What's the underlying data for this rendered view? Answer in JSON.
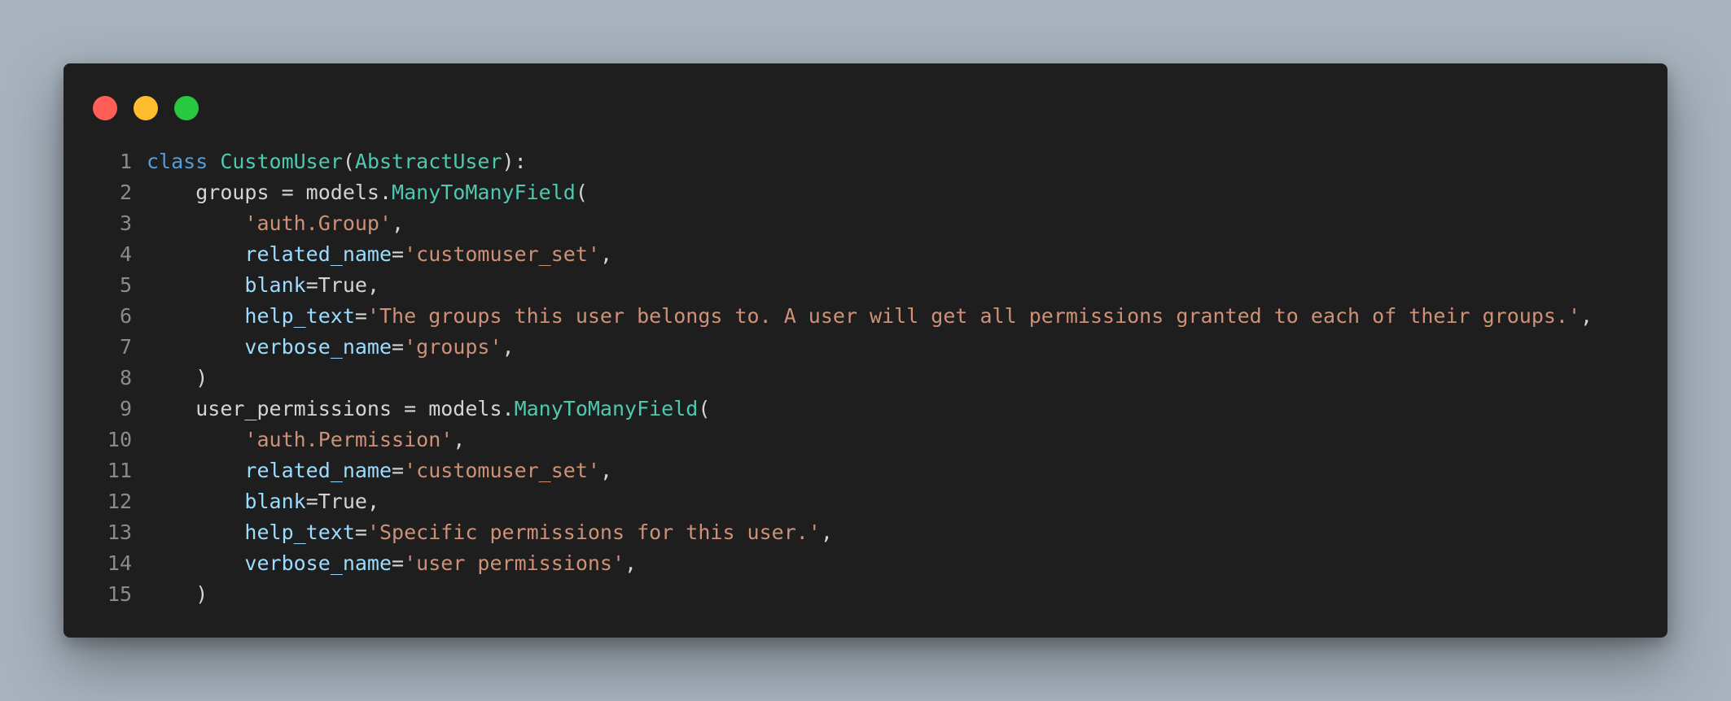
{
  "window": {
    "buttons": [
      "close",
      "minimize",
      "maximize"
    ]
  },
  "colors": {
    "keyword": "#569cd6",
    "class": "#4ec9b0",
    "string": "#ce9178",
    "parameter": "#9cdcfe",
    "text": "#d4d4d4",
    "line_number": "#8b8b8b",
    "background": "#1e1e1e"
  },
  "code": {
    "lines": [
      {
        "number": "1",
        "indent": "",
        "tokens": [
          [
            "kw",
            "class"
          ],
          [
            "plain",
            " "
          ],
          [
            "cls",
            "CustomUser"
          ],
          [
            "plain",
            "("
          ],
          [
            "cls",
            "AbstractUser"
          ],
          [
            "plain",
            "):"
          ]
        ]
      },
      {
        "number": "2",
        "indent": "    ",
        "tokens": [
          [
            "plain",
            "groups = models."
          ],
          [
            "cls",
            "ManyToManyField"
          ],
          [
            "plain",
            "("
          ]
        ]
      },
      {
        "number": "3",
        "indent": "        ",
        "tokens": [
          [
            "str",
            "'auth.Group'"
          ],
          [
            "plain",
            ","
          ]
        ]
      },
      {
        "number": "4",
        "indent": "        ",
        "tokens": [
          [
            "param",
            "related_name"
          ],
          [
            "plain",
            "="
          ],
          [
            "str",
            "'customuser_set'"
          ],
          [
            "plain",
            ","
          ]
        ]
      },
      {
        "number": "5",
        "indent": "        ",
        "tokens": [
          [
            "param",
            "blank"
          ],
          [
            "plain",
            "=True,"
          ]
        ]
      },
      {
        "number": "6",
        "indent": "        ",
        "tokens": [
          [
            "param",
            "help_text"
          ],
          [
            "plain",
            "="
          ],
          [
            "str",
            "'The groups this user belongs to. A user will get all permissions granted to each of their groups.'"
          ],
          [
            "plain",
            ","
          ]
        ]
      },
      {
        "number": "7",
        "indent": "        ",
        "tokens": [
          [
            "param",
            "verbose_name"
          ],
          [
            "plain",
            "="
          ],
          [
            "str",
            "'groups'"
          ],
          [
            "plain",
            ","
          ]
        ]
      },
      {
        "number": "8",
        "indent": "    ",
        "tokens": [
          [
            "plain",
            ")"
          ]
        ]
      },
      {
        "number": "9",
        "indent": "    ",
        "tokens": [
          [
            "plain",
            "user_permissions = models."
          ],
          [
            "cls",
            "ManyToManyField"
          ],
          [
            "plain",
            "("
          ]
        ]
      },
      {
        "number": "10",
        "indent": "        ",
        "tokens": [
          [
            "str",
            "'auth.Permission'"
          ],
          [
            "plain",
            ","
          ]
        ]
      },
      {
        "number": "11",
        "indent": "        ",
        "tokens": [
          [
            "param",
            "related_name"
          ],
          [
            "plain",
            "="
          ],
          [
            "str",
            "'customuser_set'"
          ],
          [
            "plain",
            ","
          ]
        ]
      },
      {
        "number": "12",
        "indent": "        ",
        "tokens": [
          [
            "param",
            "blank"
          ],
          [
            "plain",
            "=True,"
          ]
        ]
      },
      {
        "number": "13",
        "indent": "        ",
        "tokens": [
          [
            "param",
            "help_text"
          ],
          [
            "plain",
            "="
          ],
          [
            "str",
            "'Specific permissions for this user.'"
          ],
          [
            "plain",
            ","
          ]
        ]
      },
      {
        "number": "14",
        "indent": "        ",
        "tokens": [
          [
            "param",
            "verbose_name"
          ],
          [
            "plain",
            "="
          ],
          [
            "str",
            "'user permissions'"
          ],
          [
            "plain",
            ","
          ]
        ]
      },
      {
        "number": "15",
        "indent": "    ",
        "tokens": [
          [
            "plain",
            ")"
          ]
        ]
      }
    ]
  }
}
